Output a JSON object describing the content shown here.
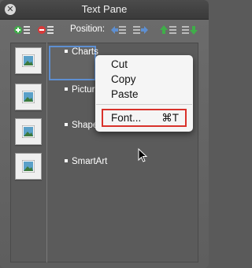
{
  "window": {
    "title": "Text Pane"
  },
  "toolbar": {
    "position_label": "Position:"
  },
  "outline": {
    "items": [
      {
        "label": "Charts"
      },
      {
        "label": "Pictur"
      },
      {
        "label": "Shape"
      },
      {
        "label": "SmartArt"
      }
    ]
  },
  "context_menu": {
    "cut": "Cut",
    "copy": "Copy",
    "paste": "Paste",
    "font": "Font...",
    "font_shortcut": "⌘T"
  },
  "colors": {
    "accent": "#5e8fd1",
    "highlight": "#d9322b",
    "add": "#3fae49",
    "remove": "#d83a3a"
  }
}
